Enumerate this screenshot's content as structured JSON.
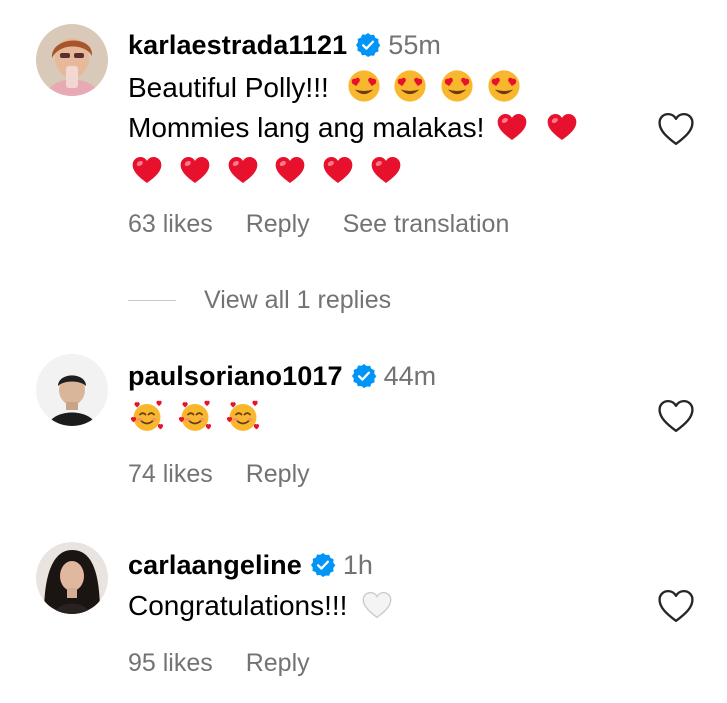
{
  "comments": [
    {
      "username": "karlaestrada1121",
      "time": "55m",
      "line1_text": "Beautiful Polly!!!",
      "line2_text": "Mommies lang ang malakas!",
      "likes": "63 likes",
      "reply": "Reply",
      "translation": "See translation",
      "view_replies": "View all 1 replies"
    },
    {
      "username": "paulsoriano1017",
      "time": "44m",
      "likes": "74 likes",
      "reply": "Reply"
    },
    {
      "username": "carlaangeline",
      "time": "1h",
      "text": "Congratulations!!!",
      "likes": "95 likes",
      "reply": "Reply"
    }
  ],
  "icons": {
    "verified": "verified-badge-icon",
    "like": "heart-outline-icon",
    "heart_eyes": "heart-eyes-emoji",
    "red_heart": "red-heart-emoji",
    "smiling_hearts": "smiling-face-with-hearts-emoji",
    "white_heart": "white-heart-emoji"
  },
  "colors": {
    "verified_blue": "#0095f6",
    "secondary_text": "#737373",
    "red_heart": "#e8112d"
  }
}
